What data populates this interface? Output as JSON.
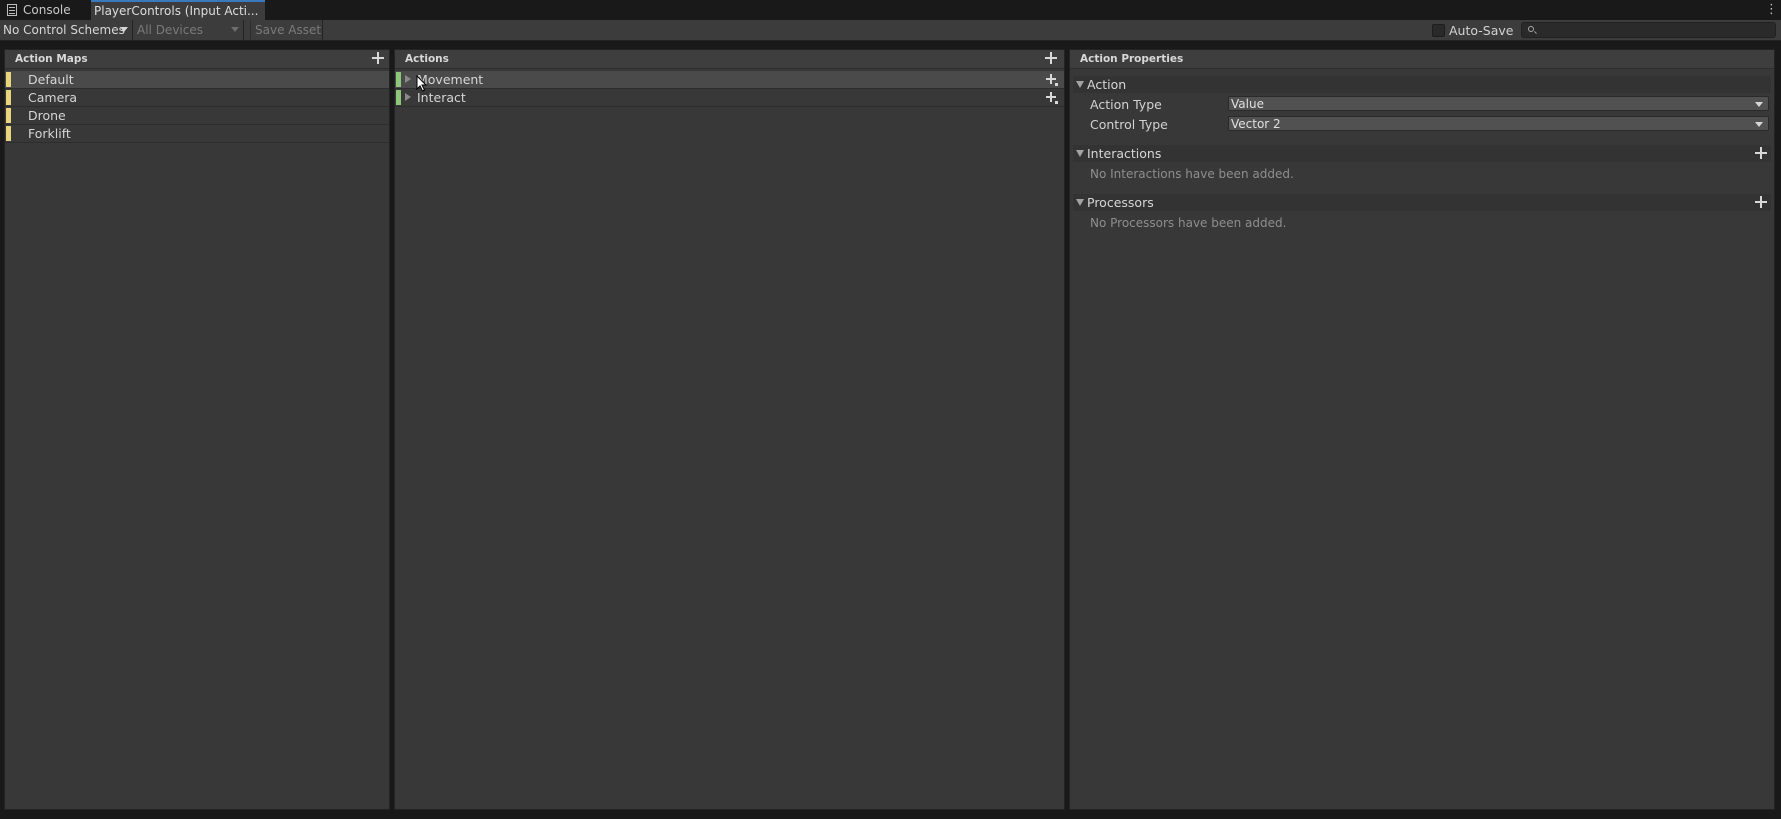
{
  "tabs": {
    "console": "Console",
    "active": "PlayerControls (Input Acti..."
  },
  "toolbar": {
    "control_schemes": "No Control Schemes",
    "devices": "All Devices",
    "save_asset": "Save Asset",
    "auto_save": "Auto-Save",
    "search_placeholder": ""
  },
  "action_maps": {
    "header": "Action Maps",
    "items": [
      {
        "label": "Default"
      },
      {
        "label": "Camera"
      },
      {
        "label": "Drone"
      },
      {
        "label": "Forklift"
      }
    ]
  },
  "actions": {
    "header": "Actions",
    "items": [
      {
        "label": "Movement"
      },
      {
        "label": "Interact"
      }
    ]
  },
  "properties": {
    "header": "Action Properties",
    "action_section": "Action",
    "action_type_label": "Action Type",
    "action_type_value": "Value",
    "control_type_label": "Control Type",
    "control_type_value": "Vector 2",
    "interactions_section": "Interactions",
    "interactions_empty": "No Interactions have been added.",
    "processors_section": "Processors",
    "processors_empty": "No Processors have been added."
  },
  "colors": {
    "accent_tab": "#3a79bb",
    "action_map_marker": "#e7d47c",
    "action_marker": "#8ec77b",
    "panel_bg": "#383838"
  }
}
